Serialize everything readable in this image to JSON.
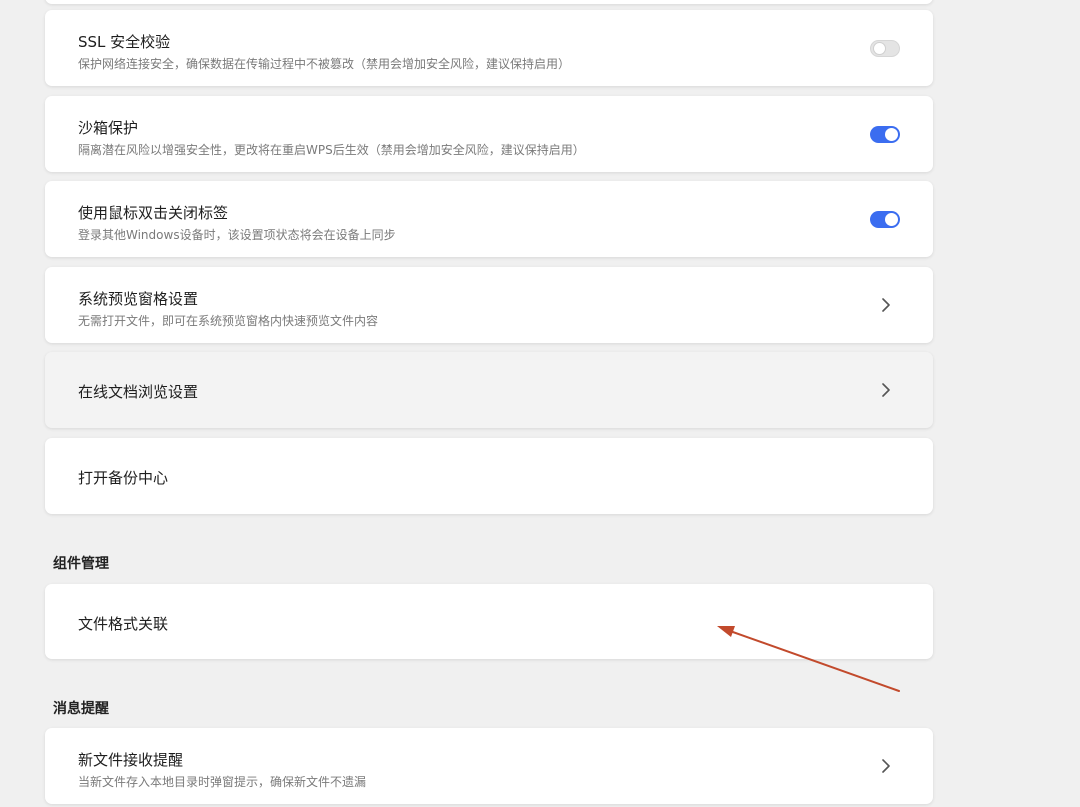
{
  "settings": {
    "ssl": {
      "title": "SSL 安全校验",
      "description": "保护网络连接安全，确保数据在传输过程中不被篡改（禁用会增加安全风险，建议保持启用）",
      "enabled": false
    },
    "sandbox": {
      "title": "沙箱保护",
      "description": "隔离潜在风险以增强安全性，更改将在重启WPS后生效（禁用会增加安全风险，建议保持启用）",
      "enabled": true
    },
    "double_click_close": {
      "title": "使用鼠标双击关闭标签",
      "description": "登录其他Windows设备时，该设置项状态将会在设备上同步",
      "enabled": true
    },
    "preview_pane": {
      "title": "系统预览窗格设置",
      "description": "无需打开文件，即可在系统预览窗格内快速预览文件内容"
    },
    "online_doc_browse": {
      "title": "在线文档浏览设置"
    },
    "backup_center": {
      "title": "打开备份中心"
    }
  },
  "component_management": {
    "header": "组件管理",
    "file_association": {
      "title": "文件格式关联"
    }
  },
  "notifications": {
    "header": "消息提醒",
    "new_file": {
      "title": "新文件接收提醒",
      "description": "当新文件存入本地目录时弹窗提示，确保新文件不遗漏"
    }
  },
  "colors": {
    "toggle_on": "#3b6df0",
    "toggle_off": "#e4e4e4",
    "annotation_arrow": "#c24a2c",
    "background": "#f0f0f0"
  },
  "icons": {
    "chevron": "chevron-right-icon",
    "annotation": "annotation-arrow"
  }
}
